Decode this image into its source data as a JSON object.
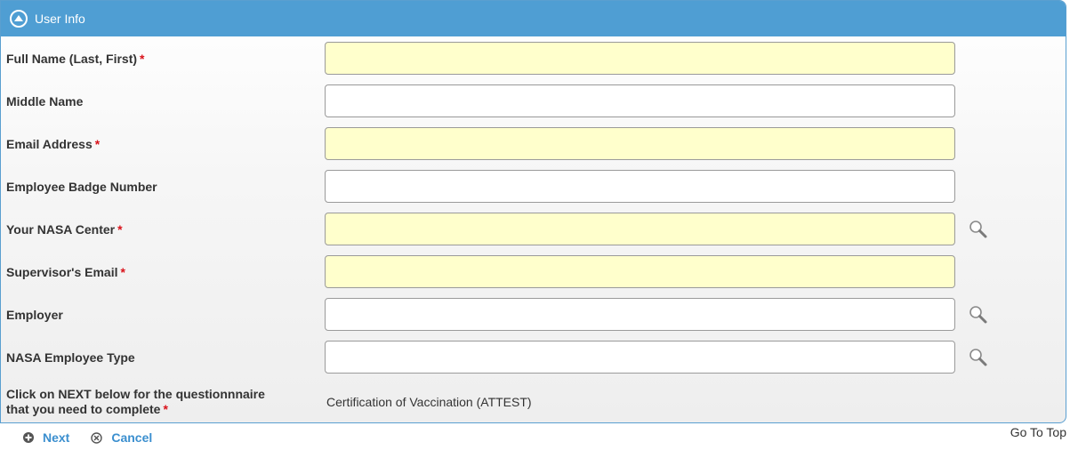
{
  "header": {
    "title": "User Info"
  },
  "fields": [
    {
      "label": "Full Name (Last, First)",
      "required": "*",
      "value": ""
    },
    {
      "label": "Middle Name",
      "required": "",
      "value": ""
    },
    {
      "label": "Email Address",
      "required": "*",
      "value": ""
    },
    {
      "label": "Employee Badge Number",
      "required": "",
      "value": ""
    },
    {
      "label": "Your NASA Center",
      "required": "*",
      "value": ""
    },
    {
      "label": "Supervisor's Email",
      "required": "*",
      "value": ""
    },
    {
      "label": "Employer",
      "required": "",
      "value": ""
    },
    {
      "label": "NASA Employee Type",
      "required": "",
      "value": ""
    }
  ],
  "questionnaire": {
    "label_line1": "Click on NEXT below for the questionnnaire",
    "label_line2": "that you need to complete",
    "required": "*",
    "value": "Certification of Vaccination (ATTEST)"
  },
  "actions": {
    "next": "Next",
    "cancel": "Cancel"
  },
  "goto_top": "Go To Top",
  "colors": {
    "header_bg": "#4f9ed3",
    "required_field_bg": "#ffffcc",
    "required_marker": "#d9121a",
    "link": "#3b8fcf"
  }
}
